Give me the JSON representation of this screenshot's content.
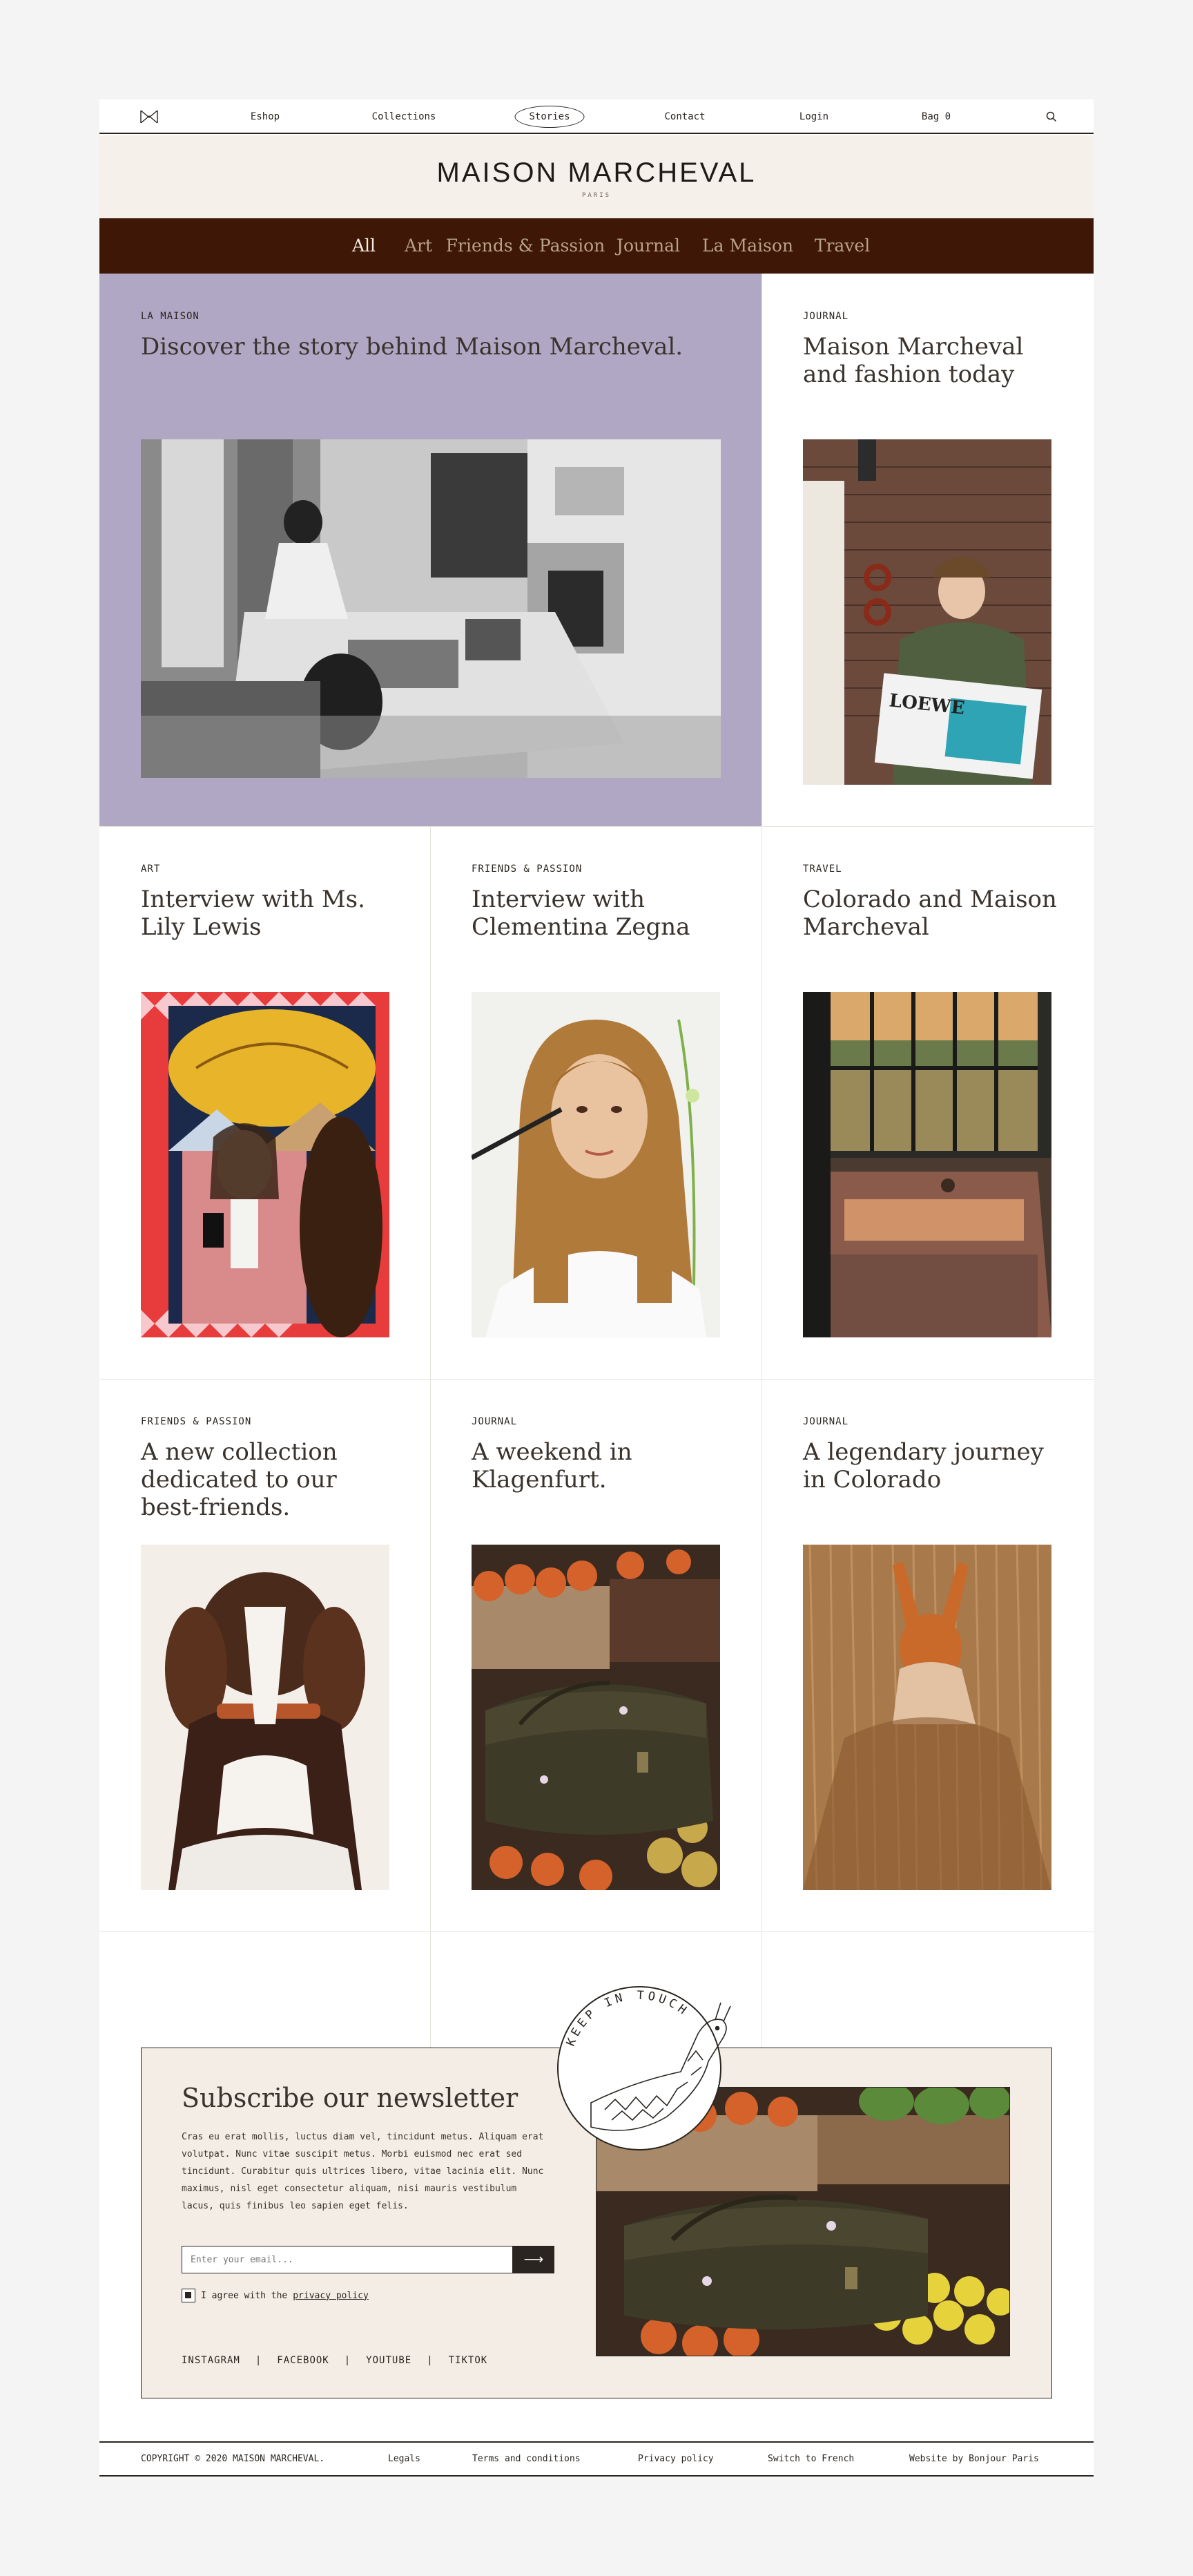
{
  "nav": {
    "items": [
      {
        "label": "Eshop"
      },
      {
        "label": "Collections"
      },
      {
        "label": "Stories"
      },
      {
        "label": "Contact"
      },
      {
        "label": "Login"
      },
      {
        "label": "Bag 0"
      }
    ],
    "active": "Stories",
    "logo_icon": "monogram-m-icon",
    "search_icon": "search-icon"
  },
  "brand": {
    "name": "MAISON MARCHEVAL",
    "city": "PARIS"
  },
  "categories": {
    "items": [
      "All",
      "Art",
      "Friends & Passion",
      "Journal",
      "La Maison",
      "Travel"
    ],
    "active": "All"
  },
  "stories": [
    {
      "tag": "LA MAISON",
      "title": "Discover the story behind Maison Marcheval."
    },
    {
      "tag": "JOURNAL",
      "title": "Maison Marcheval and fashion today"
    },
    {
      "tag": "ART",
      "title": "Interview with Ms. Lily Lewis"
    },
    {
      "tag": "FRIENDS & PASSION",
      "title": "Interview with Clementina Zegna"
    },
    {
      "tag": "TRAVEL",
      "title": "Colorado and Maison Marcheval"
    },
    {
      "tag": "FRIENDS & PASSION",
      "title": "A new collection dedicated to our best-friends."
    },
    {
      "tag": "JOURNAL",
      "title": "A weekend in Klagenfurt."
    },
    {
      "tag": "JOURNAL",
      "title": "A legendary journey in Colorado"
    }
  ],
  "newsletter": {
    "title": "Subscribe our newsletter",
    "text": "Cras eu erat mollis, luctus diam vel, tincidunt metus. Aliquam erat volutpat. Nunc vitae suscipit metus. Morbi euismod nec erat sed tincidunt. Curabitur quis ultrices libero, vitae lacinia elit. Nunc maximus, nisl eget consectetur aliquam, nisi mauris vestibulum lacus, quis finibus leo sapien eget felis.",
    "email_placeholder": "Enter your email...",
    "submit_arrow": "⟶",
    "agree_prefix": "I agree with the",
    "agree_link": "privacy policy",
    "badge_text": "KEEP IN TOUCH",
    "socials": [
      "INSTAGRAM",
      "FACEBOOK",
      "YOUTUBE",
      "TIKTOK"
    ],
    "separator": "|"
  },
  "footer": {
    "copyright": "COPYRIGHT © 2020 MAISON MARCHEVAL.",
    "links": [
      "Legals",
      "Terms and conditions",
      "Privacy policy",
      "Switch to French",
      "Website by Bonjour Paris"
    ]
  },
  "colors": {
    "featured_bg": "#b0a7c4",
    "category_bar": "#3e1706",
    "brand_bg": "#f5f1ea",
    "newsletter_bg": "#f3ede5"
  }
}
